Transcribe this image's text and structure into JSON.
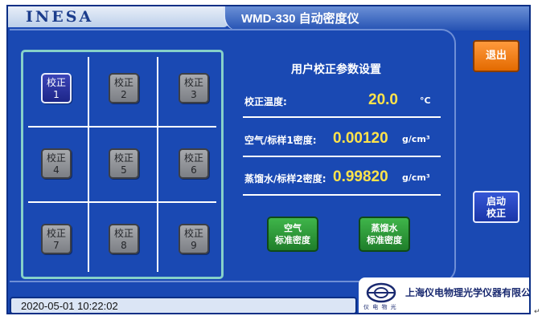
{
  "header": {
    "logo": "INESA",
    "title": "WMD-330 自动密度仪"
  },
  "grid": {
    "buttons": [
      {
        "line1": "校正",
        "line2": "1",
        "active": true
      },
      {
        "line1": "校正",
        "line2": "2",
        "active": false
      },
      {
        "line1": "校正",
        "line2": "3",
        "active": false
      },
      {
        "line1": "校正",
        "line2": "4",
        "active": false
      },
      {
        "line1": "校正",
        "line2": "5",
        "active": false
      },
      {
        "line1": "校正",
        "line2": "6",
        "active": false
      },
      {
        "line1": "校正",
        "line2": "7",
        "active": false
      },
      {
        "line1": "校正",
        "line2": "8",
        "active": false
      },
      {
        "line1": "校正",
        "line2": "9",
        "active": false
      }
    ]
  },
  "params": {
    "title": "用户校正参数设置",
    "temp_label": "校正温度:",
    "temp_value": "20.0",
    "temp_unit": "°C",
    "air_label": "空气/标样1密度:",
    "air_value": "0.00120",
    "air_unit": "g/cm³",
    "water_label": "蒸馏水/标样2密度:",
    "water_value": "0.99820",
    "water_unit": "g/cm³"
  },
  "buttons": {
    "air_std": {
      "line1": "空气",
      "line2": "标准密度"
    },
    "water_std": {
      "line1": "蒸馏水",
      "line2": "标准密度"
    },
    "exit": "退出",
    "start": {
      "line1": "启动",
      "line2": "校正"
    }
  },
  "footer": {
    "datetime": "2020-05-01 10:22:02",
    "company": "上海仪电物理光学仪器有限公司",
    "logo_sub": "仪 电 物 光"
  },
  "colors": {
    "background": "#1a49b3",
    "value_yellow": "#ffe34a",
    "exit_orange": "#e36a00",
    "green": "#2a9a36"
  }
}
